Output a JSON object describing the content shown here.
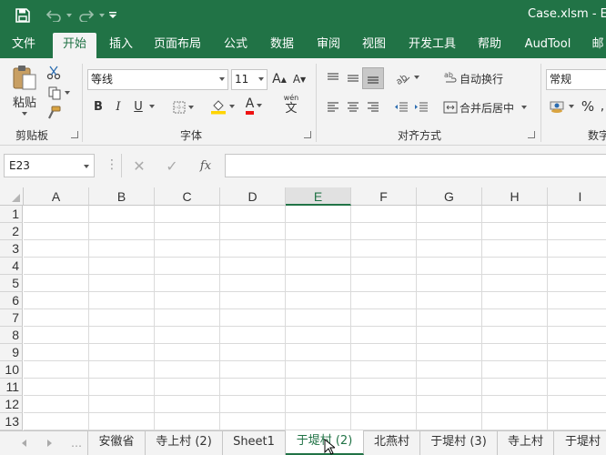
{
  "window": {
    "title": "Case.xlsm - E"
  },
  "quick_access": {
    "icons": [
      "save-icon",
      "undo-icon",
      "redo-icon",
      "customize-icon"
    ]
  },
  "ribbon_tabs": [
    {
      "label": "文件"
    },
    {
      "label": "开始",
      "active": true
    },
    {
      "label": "插入"
    },
    {
      "label": "页面布局"
    },
    {
      "label": "公式"
    },
    {
      "label": "数据"
    },
    {
      "label": "审阅"
    },
    {
      "label": "视图"
    },
    {
      "label": "开发工具"
    },
    {
      "label": "帮助"
    },
    {
      "label": "AudTool"
    },
    {
      "label": "邮"
    }
  ],
  "clipboard": {
    "paste_label": "粘贴",
    "group_label": "剪贴板"
  },
  "font": {
    "name": "等线",
    "size": "11",
    "group_label": "字体",
    "bold": "B",
    "italic": "I",
    "underline": "U",
    "grow": "A",
    "shrink": "A",
    "font_color": "A",
    "phonetic": "wén"
  },
  "alignment": {
    "wrap_text": "自动换行",
    "merge_center": "合并后居中",
    "group_label": "对齐方式"
  },
  "number": {
    "format": "常规",
    "percent": "%",
    "group_label": "数字"
  },
  "formula_bar": {
    "name_box": "E23",
    "cancel": "✕",
    "enter": "✓",
    "fx": "fx",
    "formula": ""
  },
  "columns": [
    "A",
    "B",
    "C",
    "D",
    "E",
    "F",
    "G",
    "H",
    "I"
  ],
  "selected_column": "E",
  "rows": [
    "1",
    "2",
    "3",
    "4",
    "5",
    "6",
    "7",
    "8",
    "9",
    "10",
    "11",
    "12",
    "13"
  ],
  "sheet_tabs": [
    {
      "label": "安徽省"
    },
    {
      "label": "寺上村 (2)"
    },
    {
      "label": "Sheet1"
    },
    {
      "label": "于堤村 (2)",
      "active": true
    },
    {
      "label": "北燕村"
    },
    {
      "label": "于堤村 (3)"
    },
    {
      "label": "寺上村"
    },
    {
      "label": "于堤村"
    }
  ],
  "colors": {
    "accent": "#217346",
    "ribbon_bg": "#f3f3f3",
    "gridline": "#d4d4d4"
  }
}
